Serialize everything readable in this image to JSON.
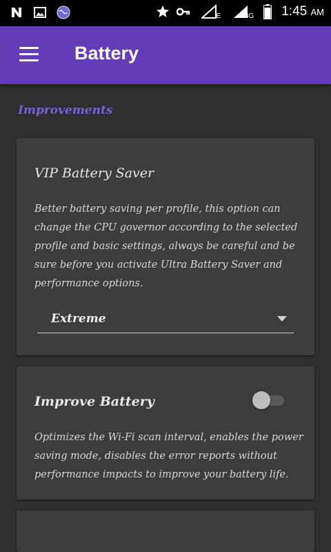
{
  "status_bar": {
    "time": "1:45",
    "ampm": "AM",
    "network_labels": [
      "E",
      "3G"
    ],
    "icons": [
      "notification-n-icon",
      "image-icon",
      "globe-icon",
      "star-icon",
      "key-icon",
      "signal-icon",
      "signal-icon",
      "battery-icon"
    ]
  },
  "app_bar": {
    "title": "Battery",
    "menu_icon": "hamburger-menu-icon"
  },
  "section": {
    "title": "Improvements"
  },
  "vip_saver": {
    "title": "VIP Battery Saver",
    "description": "Better battery saving per profile, this option can change the CPU governor according to the selected profile and basic settings, always be careful and be sure before you activate Ultra Battery Saver and performance options.",
    "selected_profile": "Extreme"
  },
  "improve_battery": {
    "title": "Improve Battery",
    "enabled": false,
    "description": "Optimizes the Wi-Fi scan interval, enables the power saving mode, disables the error reports without performance impacts to improve your battery life."
  },
  "colors": {
    "app_bar": "#663bb8",
    "accent": "#7b5fd0",
    "background": "#2f2f2f",
    "card": "#3d3d3d"
  }
}
